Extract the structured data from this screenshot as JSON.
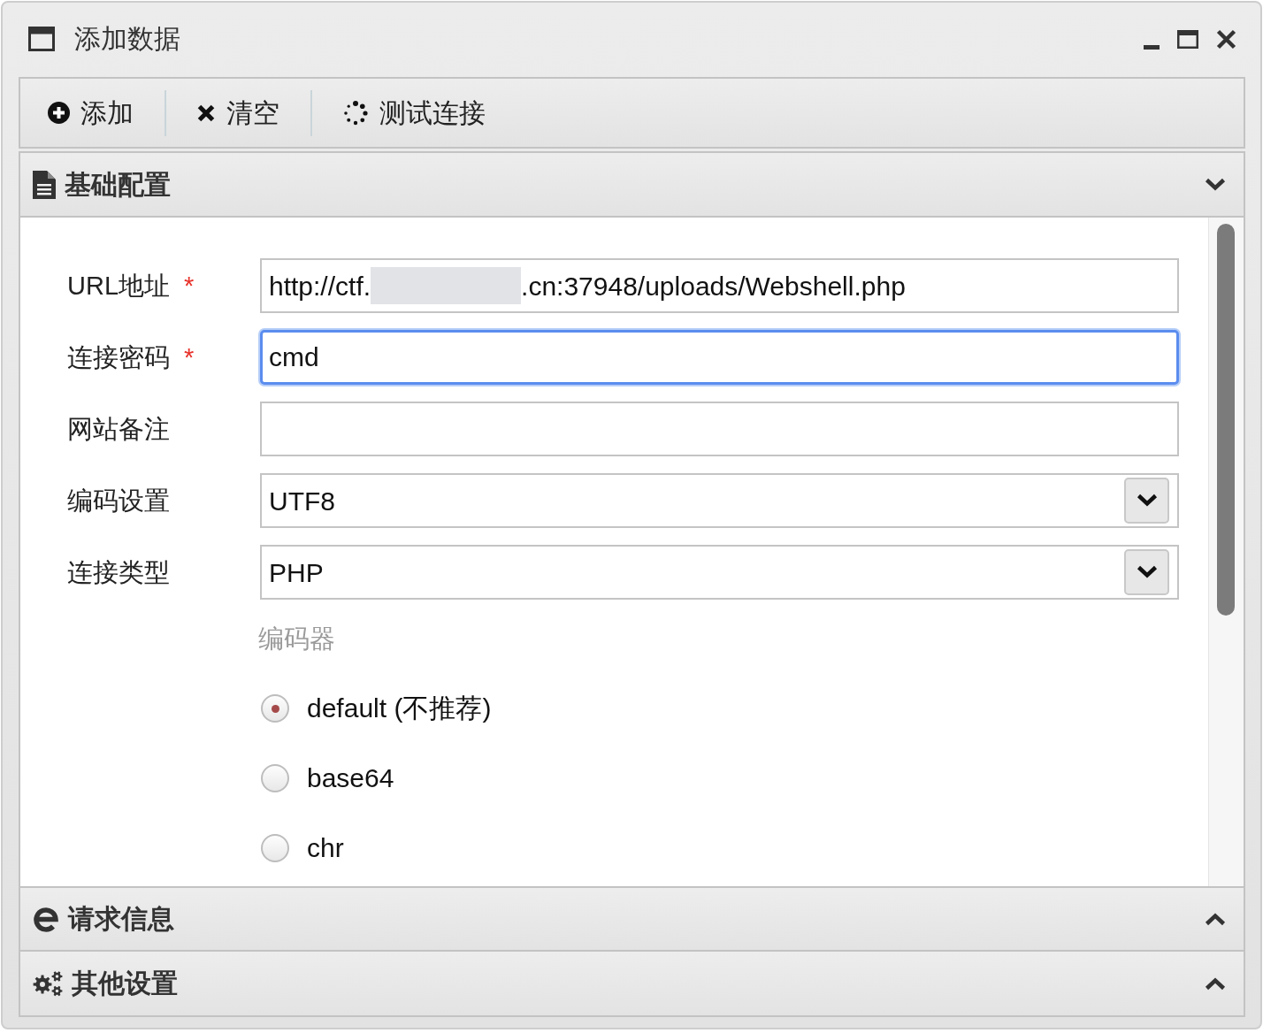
{
  "window": {
    "title": "添加数据"
  },
  "toolbar": [
    {
      "label": "添加"
    },
    {
      "label": "清空"
    },
    {
      "label": "测试连接"
    }
  ],
  "sections": [
    {
      "title": "基础配置",
      "expanded": true,
      "fields": [
        {
          "kind": "text",
          "label": "URL地址",
          "required_mark": "*",
          "value": "http://ctf.",
          "redacted": true,
          "value_after_redaction": ".cn:37948/uploads/Webshell.php",
          "focused": false
        },
        {
          "kind": "text",
          "label": "连接密码",
          "required_mark": "*",
          "value": "cmd",
          "focused": true
        },
        {
          "kind": "text",
          "label": "网站备注",
          "focused": false
        },
        {
          "kind": "select",
          "label": "编码设置",
          "value": "UTF8"
        },
        {
          "kind": "select",
          "label": "连接类型",
          "value": "PHP"
        }
      ],
      "encoder": {
        "label": "编码器",
        "options": [
          {
            "label": "default (不推荐)",
            "selected": true
          },
          {
            "label": "base64",
            "selected": false
          },
          {
            "label": "chr",
            "selected": false
          }
        ]
      }
    },
    {
      "title": "请求信息",
      "expanded": false
    },
    {
      "title": "其他设置",
      "expanded": false
    }
  ]
}
